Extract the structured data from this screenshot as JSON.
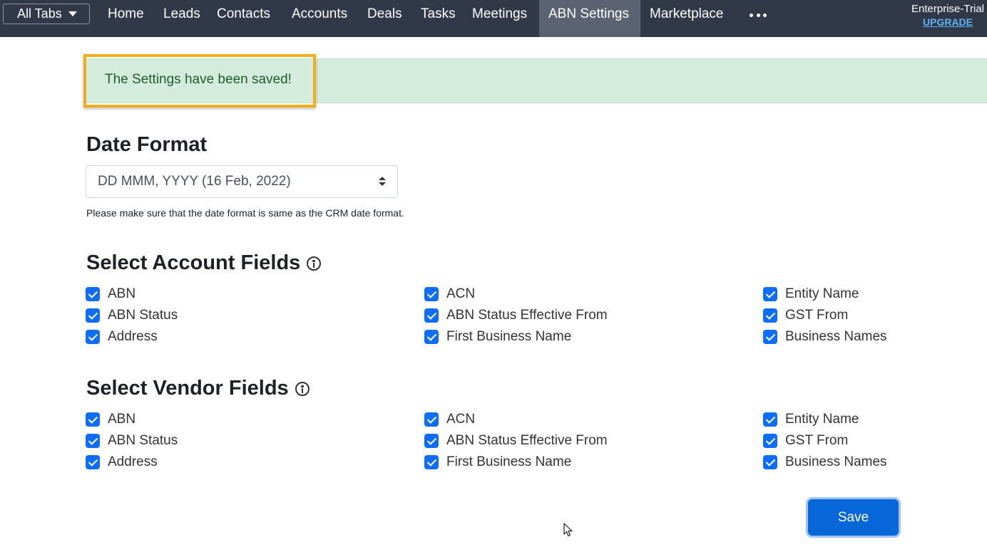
{
  "nav": {
    "all_tabs_label": "All Tabs",
    "items": [
      "Home",
      "Leads",
      "Contacts",
      "Accounts",
      "Deals",
      "Tasks",
      "Meetings",
      "ABN Settings",
      "Marketplace"
    ],
    "active_item": "ABN Settings",
    "more_icon": "ellipsis-icon",
    "plan_label": "Enterprise-Trial",
    "upgrade_label": "UPGRADE"
  },
  "alert": {
    "message": "The Settings have been saved!"
  },
  "date_format": {
    "heading": "Date Format",
    "selected_value": "DD MMM, YYYY (16 Feb, 2022)",
    "help_text": "Please make sure that the date format is same as the CRM date format."
  },
  "account_fields": {
    "heading": "Select Account Fields",
    "items": [
      {
        "label": "ABN",
        "checked": true
      },
      {
        "label": "ABN Status",
        "checked": true
      },
      {
        "label": "Address",
        "checked": true
      },
      {
        "label": "ACN",
        "checked": true
      },
      {
        "label": "ABN Status Effective From",
        "checked": true
      },
      {
        "label": "First Business Name",
        "checked": true
      },
      {
        "label": "Entity Name",
        "checked": true
      },
      {
        "label": "GST From",
        "checked": true
      },
      {
        "label": "Business Names",
        "checked": true
      }
    ]
  },
  "vendor_fields": {
    "heading": "Select Vendor Fields",
    "items": [
      {
        "label": "ABN",
        "checked": true
      },
      {
        "label": "ABN Status",
        "checked": true
      },
      {
        "label": "Address",
        "checked": true
      },
      {
        "label": "ACN",
        "checked": true
      },
      {
        "label": "ABN Status Effective From",
        "checked": true
      },
      {
        "label": "First Business Name",
        "checked": true
      },
      {
        "label": "Entity Name",
        "checked": true
      },
      {
        "label": "GST From",
        "checked": true
      },
      {
        "label": "Business Names",
        "checked": true
      }
    ]
  },
  "actions": {
    "save_label": "Save"
  },
  "colors": {
    "topbar": "#313949",
    "active_tab": "#5b6372",
    "checkbox": "#0d6efd",
    "alert_bg": "#d4ecdb",
    "alert_highlight": "#f1ae1b",
    "save_button": "#0767d9"
  }
}
